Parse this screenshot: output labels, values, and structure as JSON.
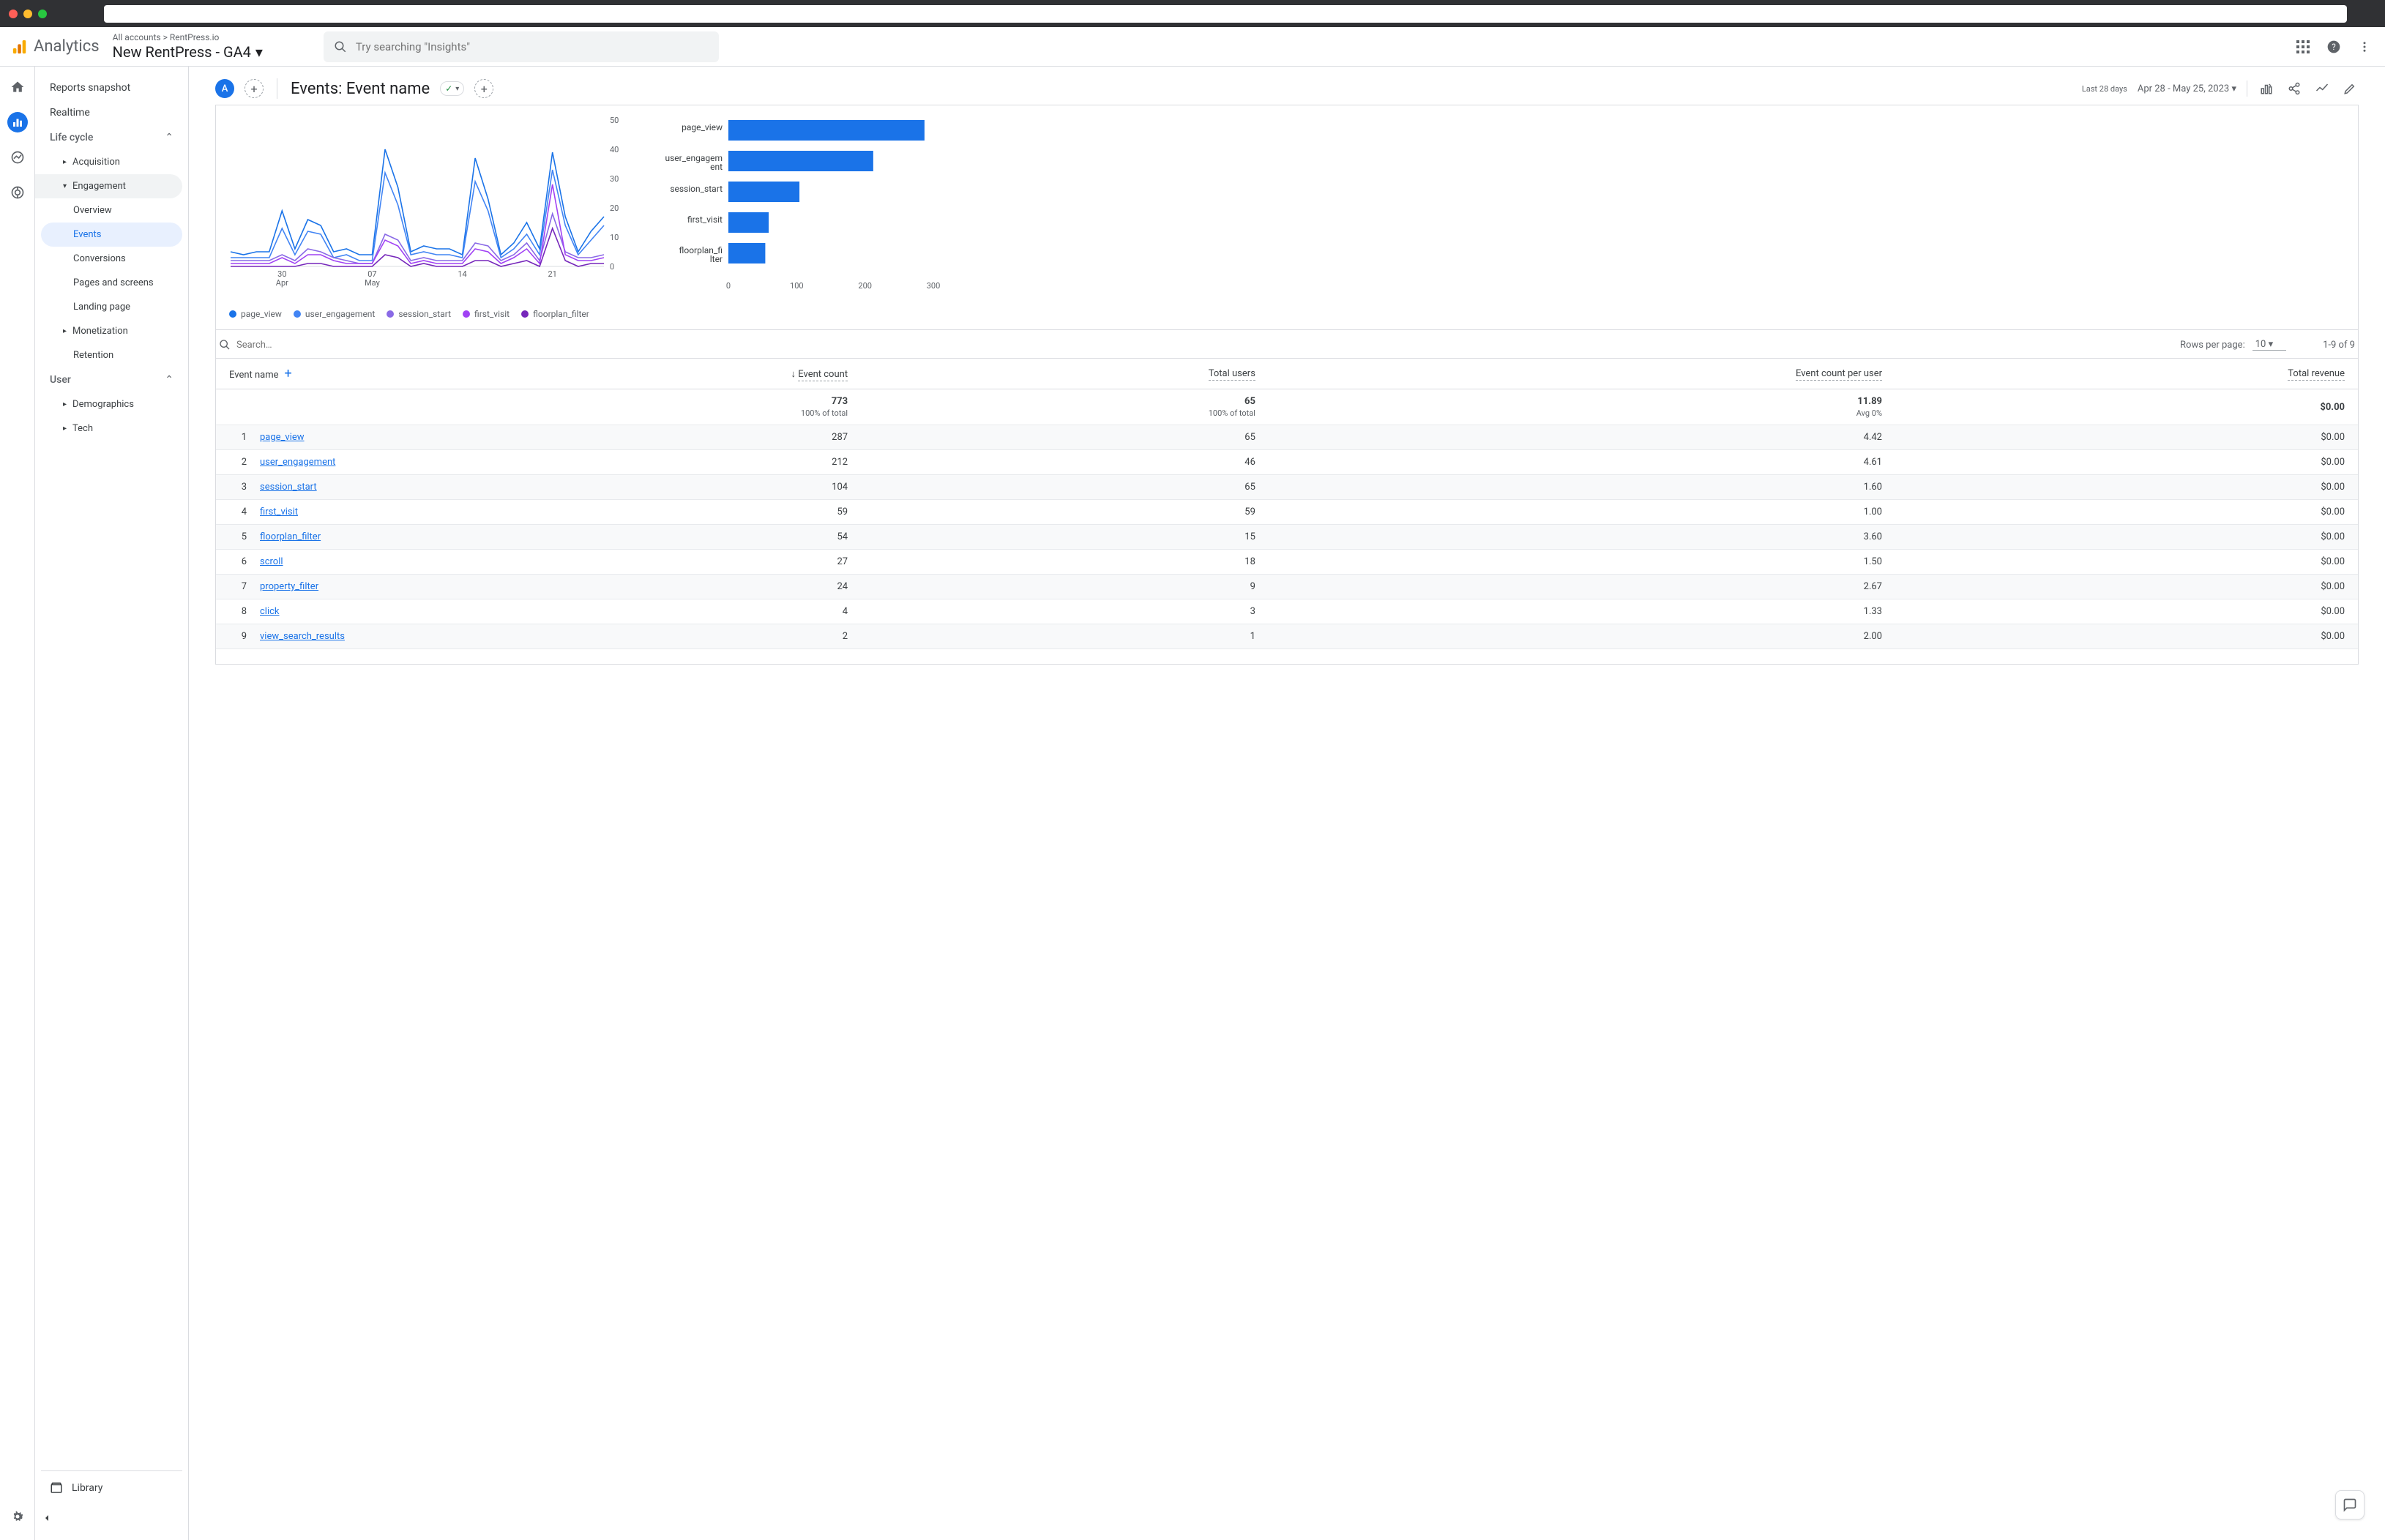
{
  "header": {
    "product": "Analytics",
    "breadcrumb_all": "All accounts",
    "breadcrumb_acct": "RentPress.io",
    "property": "New RentPress - GA4",
    "search_placeholder": "Try searching \"Insights\""
  },
  "side": {
    "snapshot": "Reports snapshot",
    "realtime": "Realtime",
    "lifecycle": "Life cycle",
    "acquisition": "Acquisition",
    "engagement": "Engagement",
    "engagement_items": [
      "Overview",
      "Events",
      "Conversions",
      "Pages and screens",
      "Landing page"
    ],
    "monetization": "Monetization",
    "retention": "Retention",
    "user": "User",
    "demographics": "Demographics",
    "tech": "Tech",
    "library": "Library"
  },
  "page": {
    "chip": "A",
    "title": "Events: Event name",
    "period_label": "Last 28 days",
    "date_range": "Apr 28 - May 25, 2023"
  },
  "chart_data": [
    {
      "type": "line",
      "ylim": [
        0,
        50
      ],
      "yticks": [
        0,
        10,
        20,
        30,
        40,
        50
      ],
      "x_labels": [
        "30 Apr",
        "07 May",
        "14",
        "21"
      ],
      "x_label_pos": [
        4,
        11,
        18,
        25
      ],
      "days": 30,
      "series": [
        {
          "name": "page_view",
          "color": "#1a73e8",
          "values": [
            5,
            4,
            5,
            5,
            19,
            6,
            16,
            14,
            5,
            6,
            4,
            4,
            40,
            27,
            5,
            7,
            6,
            6,
            4,
            37,
            23,
            4,
            8,
            15,
            6,
            39,
            17,
            5,
            12,
            17
          ]
        },
        {
          "name": "user_engagement",
          "color": "#4285f4",
          "values": [
            3,
            3,
            3,
            3,
            13,
            4,
            12,
            11,
            3,
            4,
            2,
            2,
            32,
            21,
            4,
            5,
            4,
            4,
            3,
            29,
            19,
            3,
            6,
            11,
            4,
            33,
            14,
            4,
            9,
            14
          ]
        },
        {
          "name": "session_start",
          "color": "#8a6ae6",
          "values": [
            2,
            2,
            2,
            2,
            4,
            2,
            6,
            5,
            3,
            2,
            1,
            1,
            11,
            9,
            2,
            3,
            2,
            2,
            2,
            8,
            7,
            2,
            4,
            8,
            2,
            18,
            5,
            3,
            3,
            4
          ]
        },
        {
          "name": "first_visit",
          "color": "#a142f4",
          "values": [
            1,
            1,
            1,
            1,
            3,
            1,
            4,
            4,
            2,
            1,
            1,
            1,
            9,
            7,
            1,
            2,
            1,
            1,
            1,
            6,
            5,
            1,
            3,
            6,
            1,
            28,
            4,
            2,
            2,
            3
          ]
        },
        {
          "name": "floorplan_filter",
          "color": "#7627bb",
          "values": [
            0,
            0,
            0,
            0,
            0,
            0,
            1,
            1,
            0,
            0,
            0,
            0,
            4,
            3,
            0,
            1,
            0,
            0,
            0,
            2,
            2,
            0,
            1,
            2,
            0,
            13,
            2,
            0,
            1,
            1
          ]
        }
      ]
    },
    {
      "type": "bar",
      "xlim": [
        0,
        300
      ],
      "xticks": [
        0,
        100,
        200,
        300
      ],
      "categories": [
        "page_view",
        "user_engagement",
        "session_start",
        "first_visit",
        "floorplan_filter"
      ],
      "values": [
        287,
        212,
        104,
        59,
        54
      ]
    }
  ],
  "legend": [
    {
      "label": "page_view",
      "color": "#1a73e8"
    },
    {
      "label": "user_engagement",
      "color": "#4285f4"
    },
    {
      "label": "session_start",
      "color": "#8a6ae6"
    },
    {
      "label": "first_visit",
      "color": "#a142f4"
    },
    {
      "label": "floorplan_filter",
      "color": "#7627bb"
    }
  ],
  "table": {
    "search_placeholder": "Search…",
    "rows_per_page_label": "Rows per page:",
    "rows_per_page_value": "10",
    "range_text": "1-9 of 9",
    "columns": [
      "Event name",
      "Event count",
      "Total users",
      "Event count per user",
      "Total revenue"
    ],
    "totals": {
      "event_count": "773",
      "event_count_sub": "100% of total",
      "total_users": "65",
      "total_users_sub": "100% of total",
      "per_user": "11.89",
      "per_user_sub": "Avg 0%",
      "revenue": "$0.00"
    },
    "rows": [
      {
        "i": 1,
        "name": "page_view",
        "count": "287",
        "users": "65",
        "per": "4.42",
        "rev": "$0.00"
      },
      {
        "i": 2,
        "name": "user_engagement",
        "count": "212",
        "users": "46",
        "per": "4.61",
        "rev": "$0.00"
      },
      {
        "i": 3,
        "name": "session_start",
        "count": "104",
        "users": "65",
        "per": "1.60",
        "rev": "$0.00"
      },
      {
        "i": 4,
        "name": "first_visit",
        "count": "59",
        "users": "59",
        "per": "1.00",
        "rev": "$0.00"
      },
      {
        "i": 5,
        "name": "floorplan_filter",
        "count": "54",
        "users": "15",
        "per": "3.60",
        "rev": "$0.00"
      },
      {
        "i": 6,
        "name": "scroll",
        "count": "27",
        "users": "18",
        "per": "1.50",
        "rev": "$0.00"
      },
      {
        "i": 7,
        "name": "property_filter",
        "count": "24",
        "users": "9",
        "per": "2.67",
        "rev": "$0.00"
      },
      {
        "i": 8,
        "name": "click",
        "count": "4",
        "users": "3",
        "per": "1.33",
        "rev": "$0.00"
      },
      {
        "i": 9,
        "name": "view_search_results",
        "count": "2",
        "users": "1",
        "per": "2.00",
        "rev": "$0.00"
      }
    ]
  }
}
